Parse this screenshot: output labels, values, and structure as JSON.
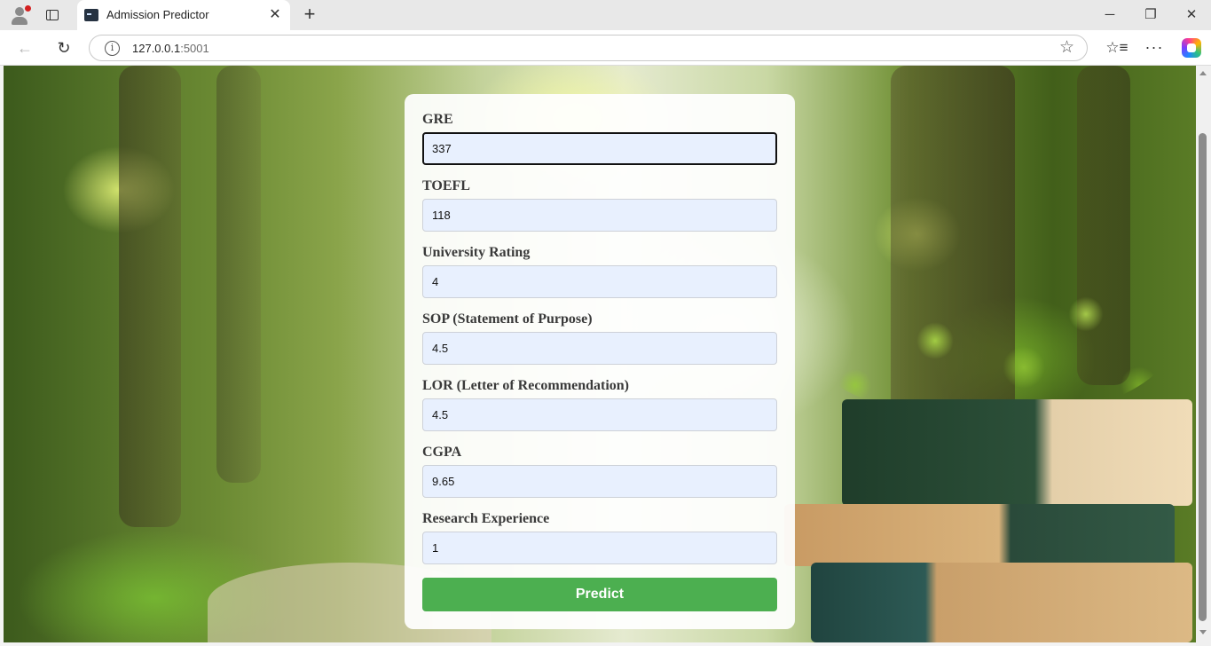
{
  "browser": {
    "tab_title": "Admission Predictor",
    "tab_close_symbol": "✕",
    "new_tab_symbol": "+",
    "url_host": "127.0.0.1",
    "url_port": ":5001",
    "window_controls": {
      "minimize": "─",
      "restore": "❐",
      "close": "✕"
    },
    "icons": {
      "back": "back-arrow-icon",
      "reload": "reload-icon",
      "site_info": "info-icon",
      "favorite": "star-icon",
      "favorites": "favorites-icon",
      "menu": "more-icon",
      "copilot": "copilot-icon"
    },
    "glyphs": {
      "back": "←",
      "reload": "↻",
      "info": "i",
      "star": "☆",
      "favorites": "☆≡",
      "menu": "···"
    }
  },
  "form": {
    "fields": [
      {
        "label": "GRE",
        "value": "337",
        "focused": true
      },
      {
        "label": "TOEFL",
        "value": "118"
      },
      {
        "label": "University Rating",
        "value": "4"
      },
      {
        "label": "SOP (Statement of Purpose)",
        "value": "4.5"
      },
      {
        "label": "LOR (Letter of Recommendation)",
        "value": "4.5"
      },
      {
        "label": "CGPA",
        "value": "9.65"
      },
      {
        "label": "Research Experience",
        "value": "1"
      }
    ],
    "submit_label": "Predict",
    "submit_color": "#4caf50",
    "input_background": "#e8f0fe"
  }
}
